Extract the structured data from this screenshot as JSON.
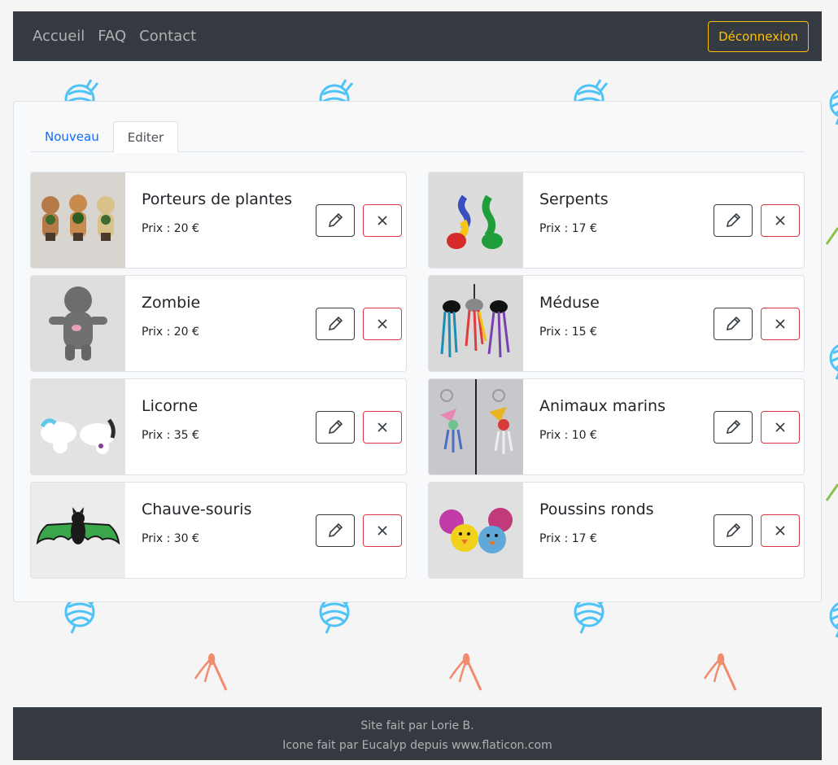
{
  "nav": {
    "links": [
      "Accueil",
      "FAQ",
      "Contact"
    ],
    "logout_label": "Déconnexion"
  },
  "tabs": [
    {
      "label": "Nouveau",
      "active": false
    },
    {
      "label": "Editer",
      "active": true
    }
  ],
  "products": [
    {
      "name": "Porteurs de plantes",
      "price": "Prix : 20 €",
      "image": "plant-holders-photo"
    },
    {
      "name": "Serpents",
      "price": "Prix : 17 €",
      "image": "snakes-photo"
    },
    {
      "name": "Zombie",
      "price": "Prix : 20 €",
      "image": "zombie-photo"
    },
    {
      "name": "Méduse",
      "price": "Prix : 15 €",
      "image": "jellyfish-photo"
    },
    {
      "name": "Licorne",
      "price": "Prix : 35 €",
      "image": "unicorn-photo"
    },
    {
      "name": "Animaux marins",
      "price": "Prix : 10 €",
      "image": "sea-animals-photo"
    },
    {
      "name": "Chauve-souris",
      "price": "Prix : 30 €",
      "image": "bat-photo"
    },
    {
      "name": "Poussins ronds",
      "price": "Prix : 17 €",
      "image": "round-chicks-photo"
    }
  ],
  "footer": {
    "line1": "Site fait par Lorie B.",
    "line2": "Icone fait par Eucalyp depuis www.flaticon.com"
  },
  "colors": {
    "navbar": "#343a40",
    "accent_warning": "#ffc107",
    "danger": "#dc3545",
    "link": "#0d6efd",
    "yarn_icon": "#4fc3f7",
    "needle_icon": "#f28b6e",
    "green_needle": "#8bc34a"
  }
}
